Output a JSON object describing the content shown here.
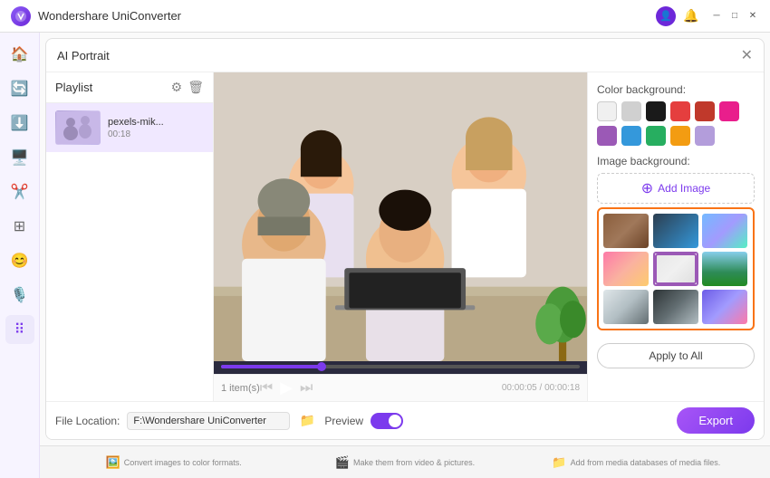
{
  "app": {
    "title": "Wondershare UniConverter",
    "title_bar_controls": {
      "minimize": "─",
      "maximize": "□",
      "close": "✕"
    }
  },
  "panel": {
    "title": "AI Portrait",
    "close": "✕"
  },
  "playlist": {
    "title": "Playlist",
    "items": [
      {
        "name": "pexels-mik...",
        "duration": "00:18"
      }
    ]
  },
  "video": {
    "item_count": "1 item(s)",
    "time_current": "00:00:05",
    "time_total": "00:00:18",
    "time_display": "00:00:05 / 00:00:18"
  },
  "file_bar": {
    "label": "File Location:",
    "path": "F:\\Wondershare UniConverter",
    "preview_label": "Preview"
  },
  "right_panel": {
    "color_bg_label": "Color background:",
    "image_bg_label": "Image background:",
    "add_image_label": "Add Image",
    "apply_all_label": "Apply to All"
  },
  "bottom_bar": {
    "items": [
      {
        "icon": "🖼️",
        "text": "Convert images to color formats."
      },
      {
        "icon": "🎬",
        "text": "Make them from video & pictures."
      },
      {
        "icon": "📁",
        "text": "Add from media databases of media files."
      }
    ]
  },
  "export_button": "Export",
  "colors": {
    "accent": "#7c3aed",
    "orange_border": "#f97316"
  }
}
